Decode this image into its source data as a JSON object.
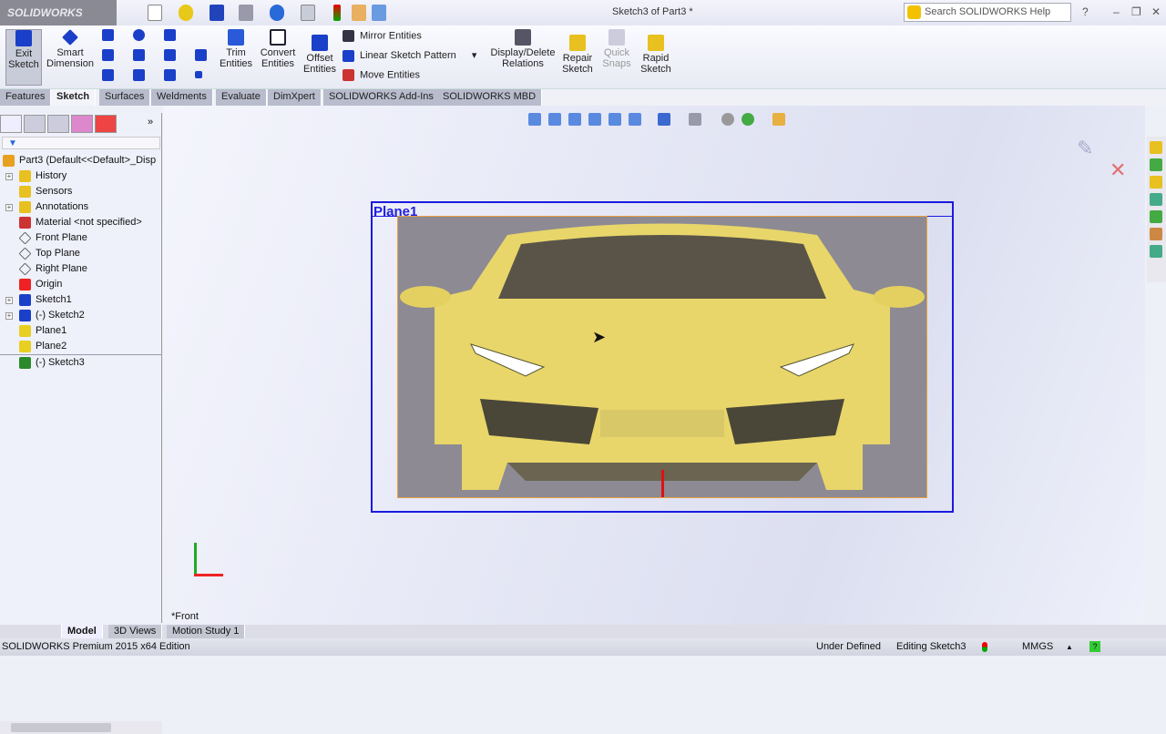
{
  "app": {
    "brand": "SOLIDWORKS",
    "window_title": "Sketch3 of Part3 *",
    "search_placeholder": "Search SOLIDWORKS Help"
  },
  "ribbon": {
    "exit_sketch": "Exit\nSketch",
    "smart_dimension": "Smart\nDimension",
    "trim_entities": "Trim\nEntities",
    "convert_entities": "Convert\nEntities",
    "offset_entities": "Offset\nEntities",
    "mirror_entities": "Mirror Entities",
    "linear_sketch_pattern": "Linear Sketch Pattern",
    "move_entities": "Move Entities",
    "display_delete_relations": "Display/Delete\nRelations",
    "repair_sketch": "Repair\nSketch",
    "quick_snaps": "Quick\nSnaps",
    "rapid_sketch": "Rapid\nSketch"
  },
  "tabs": [
    {
      "label": "Features"
    },
    {
      "label": "Sketch",
      "active": true
    },
    {
      "label": "Surfaces"
    },
    {
      "label": "Weldments"
    },
    {
      "label": "Evaluate"
    },
    {
      "label": "DimXpert"
    },
    {
      "label": "SOLIDWORKS Add-Ins"
    },
    {
      "label": "SOLIDWORKS MBD"
    }
  ],
  "tree": {
    "root": "Part3  (Default<<Default>_Disp",
    "items": [
      {
        "label": "History",
        "icon": "history-icon",
        "expand": true
      },
      {
        "label": "Sensors",
        "icon": "sensors-icon"
      },
      {
        "label": "Annotations",
        "icon": "annotations-icon",
        "expand": true
      },
      {
        "label": "Material <not specified>",
        "icon": "material-icon"
      },
      {
        "label": "Front Plane",
        "icon": "plane-icon"
      },
      {
        "label": "Top Plane",
        "icon": "plane-icon"
      },
      {
        "label": "Right Plane",
        "icon": "plane-icon"
      },
      {
        "label": "Origin",
        "icon": "origin-icon"
      },
      {
        "label": "Sketch1",
        "icon": "sketch-icon",
        "expand": true
      },
      {
        "label": "(-) Sketch2",
        "icon": "sketch-icon",
        "expand": true
      },
      {
        "label": "Plane1",
        "icon": "ref-plane-icon"
      },
      {
        "label": "Plane2",
        "icon": "ref-plane-icon"
      },
      {
        "label": "(-) Sketch3",
        "icon": "sketch-edit-icon"
      }
    ]
  },
  "viewport": {
    "plane_label": "Plane1",
    "view_label": "*Front"
  },
  "bottom_tabs": [
    {
      "label": "Model",
      "active": true
    },
    {
      "label": "3D Views"
    },
    {
      "label": "Motion Study 1"
    }
  ],
  "status": {
    "edition": "SOLIDWORKS Premium 2015 x64 Edition",
    "defined": "Under Defined",
    "editing": "Editing Sketch3",
    "units": "MMGS"
  },
  "colors": {
    "sketch_blue": "#1a1ae0",
    "car_yellow": "#f0dc6a",
    "origin_red": "#e01010"
  }
}
